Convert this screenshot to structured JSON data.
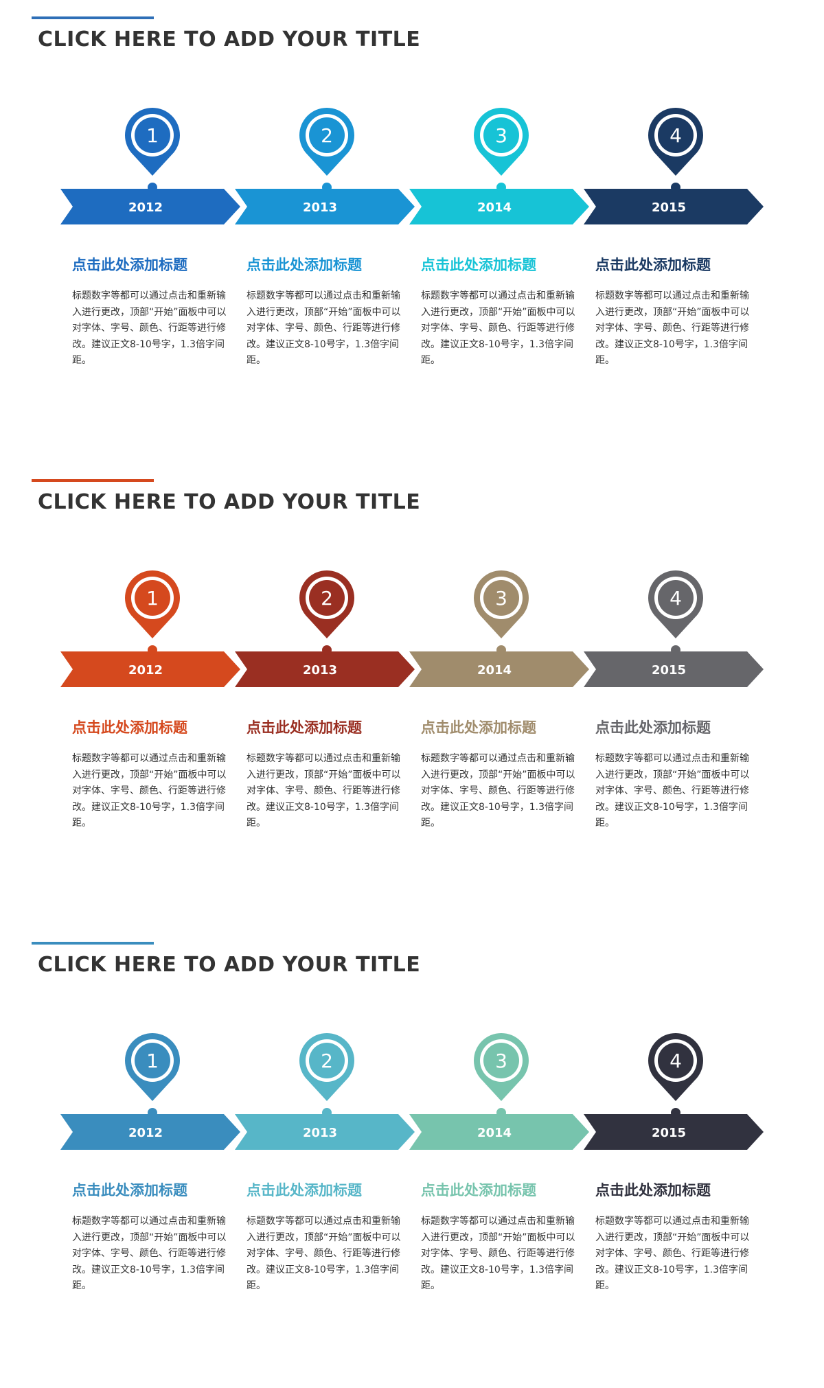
{
  "slides": [
    {
      "title": "CLICK HERE TO ADD YOUR TITLE",
      "accent_color": "#2E6FB7",
      "steps": [
        {
          "number": "1",
          "year": "2012",
          "color": "#1E6CC0",
          "heading": "点击此处添加标题",
          "body": "标题数字等都可以通过点击和重新输入进行更改，顶部“开始”面板中可以对字体、字号、颜色、行距等进行修改。建议正文8-10号字，1.3倍字间距。"
        },
        {
          "number": "2",
          "year": "2013",
          "color": "#1A94D4",
          "heading": "点击此处添加标题",
          "body": "标题数字等都可以通过点击和重新输入进行更改，顶部“开始”面板中可以对字体、字号、颜色、行距等进行修改。建议正文8-10号字，1.3倍字间距。"
        },
        {
          "number": "3",
          "year": "2014",
          "color": "#17C3D6",
          "heading": "点击此处添加标题",
          "body": "标题数字等都可以通过点击和重新输入进行更改，顶部“开始”面板中可以对字体、字号、颜色、行距等进行修改。建议正文8-10号字，1.3倍字间距。"
        },
        {
          "number": "4",
          "year": "2015",
          "color": "#1B3A63",
          "heading": "点击此处添加标题",
          "body": "标题数字等都可以通过点击和重新输入进行更改，顶部“开始”面板中可以对字体、字号、颜色、行距等进行修改。建议正文8-10号字，1.3倍字间距。"
        }
      ]
    },
    {
      "title": "CLICK HERE TO ADD YOUR TITLE",
      "accent_color": "#D5491E",
      "steps": [
        {
          "number": "1",
          "year": "2012",
          "color": "#D5491E",
          "heading": "点击此处添加标题",
          "body": "标题数字等都可以通过点击和重新输入进行更改，顶部“开始”面板中可以对字体、字号、颜色、行距等进行修改。建议正文8-10号字，1.3倍字间距。"
        },
        {
          "number": "2",
          "year": "2013",
          "color": "#9A2F22",
          "heading": "点击此处添加标题",
          "body": "标题数字等都可以通过点击和重新输入进行更改，顶部“开始”面板中可以对字体、字号、颜色、行距等进行修改。建议正文8-10号字，1.3倍字间距。"
        },
        {
          "number": "3",
          "year": "2014",
          "color": "#A08C6C",
          "heading": "点击此处添加标题",
          "body": "标题数字等都可以通过点击和重新输入进行更改，顶部“开始”面板中可以对字体、字号、颜色、行距等进行修改。建议正文8-10号字，1.3倍字间距。"
        },
        {
          "number": "4",
          "year": "2015",
          "color": "#66666A",
          "heading": "点击此处添加标题",
          "body": "标题数字等都可以通过点击和重新输入进行更改，顶部“开始”面板中可以对字体、字号、颜色、行距等进行修改。建议正文8-10号字，1.3倍字间距。"
        }
      ]
    },
    {
      "title": "CLICK HERE TO ADD YOUR TITLE",
      "accent_color": "#3A8DBE",
      "steps": [
        {
          "number": "1",
          "year": "2012",
          "color": "#3A8DBE",
          "heading": "点击此处添加标题",
          "body": "标题数字等都可以通过点击和重新输入进行更改，顶部“开始”面板中可以对字体、字号、颜色、行距等进行修改。建议正文8-10号字，1.3倍字间距。"
        },
        {
          "number": "2",
          "year": "2013",
          "color": "#57B6C8",
          "heading": "点击此处添加标题",
          "body": "标题数字等都可以通过点击和重新输入进行更改，顶部“开始”面板中可以对字体、字号、颜色、行距等进行修改。建议正文8-10号字，1.3倍字间距。"
        },
        {
          "number": "3",
          "year": "2014",
          "color": "#77C4AD",
          "heading": "点击此处添加标题",
          "body": "标题数字等都可以通过点击和重新输入进行更改，顶部“开始”面板中可以对字体、字号、颜色、行距等进行修改。建议正文8-10号字，1.3倍字间距。"
        },
        {
          "number": "4",
          "year": "2015",
          "color": "#31323F",
          "heading": "点击此处添加标题",
          "body": "标题数字等都可以通过点击和重新输入进行更改，顶部“开始”面板中可以对字体、字号、颜色、行距等进行修改。建议正文8-10号字，1.3倍字间距。"
        }
      ]
    }
  ]
}
